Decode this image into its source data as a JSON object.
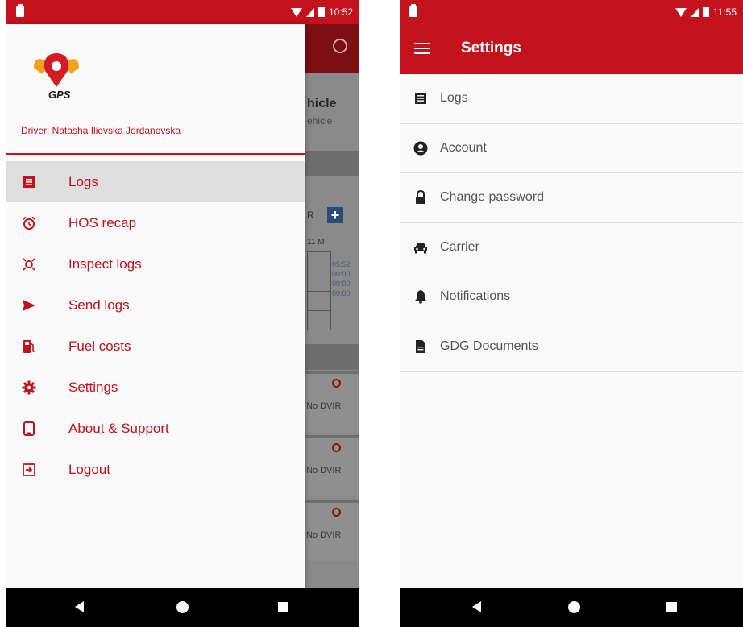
{
  "left_screen": {
    "status": {
      "time": "10:52"
    },
    "background_app": {
      "title": "hicle",
      "subtitle": "ehicle",
      "label_r": "R",
      "label_m": "11 M",
      "times": [
        "05:52",
        "00:00",
        "00:00",
        "00:00"
      ],
      "dvir_cards": [
        "No DVIR",
        "No DVIR",
        "No DVIR"
      ]
    },
    "drawer": {
      "logo_text": "GPS",
      "driver": "Driver: Natasha Ilievska Jordanovska",
      "items": [
        {
          "label": "Logs",
          "icon": "list-icon",
          "active": true
        },
        {
          "label": "HOS recap",
          "icon": "alarm-icon"
        },
        {
          "label": "Inspect logs",
          "icon": "inspect-icon"
        },
        {
          "label": "Send logs",
          "icon": "send-icon"
        },
        {
          "label": "Fuel costs",
          "icon": "fuel-icon"
        },
        {
          "label": "Settings",
          "icon": "gear-icon"
        },
        {
          "label": "About & Support",
          "icon": "phone-icon"
        },
        {
          "label": "Logout",
          "icon": "logout-icon"
        }
      ]
    }
  },
  "right_screen": {
    "status": {
      "time": "11:55"
    },
    "toolbar": {
      "title": "Settings"
    },
    "settings": [
      {
        "label": "Logs",
        "icon": "list-icon"
      },
      {
        "label": "Account",
        "icon": "account-icon"
      },
      {
        "label": "Change password",
        "icon": "lock-icon"
      },
      {
        "label": "Carrier",
        "icon": "car-icon"
      },
      {
        "label": "Notifications",
        "icon": "bell-icon"
      },
      {
        "label": "GDG Documents",
        "icon": "document-icon"
      }
    ]
  },
  "colors": {
    "brand_red": "#c4121c",
    "nav_black": "#000000",
    "logo_orange": "#f4a21b"
  }
}
